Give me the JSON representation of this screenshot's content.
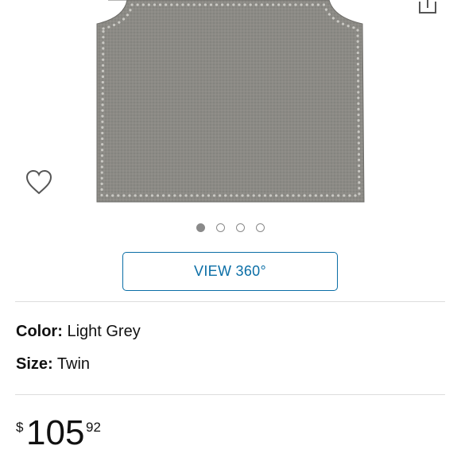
{
  "colors": {
    "accent": "#0a6ea6",
    "divider": "#dddddd",
    "fabric": "#8b8a85",
    "dot_active": "#8a8a8a"
  },
  "gallery": {
    "image_name": "headboard-product-image",
    "image_count": 4,
    "active_index": 0
  },
  "icons": {
    "wishlist": "heart-outline-icon",
    "share": "share-icon"
  },
  "view360": {
    "label": "VIEW 360°"
  },
  "attributes": {
    "color_label": "Color:",
    "color_value": "Light Grey",
    "size_label": "Size:",
    "size_value": "Twin"
  },
  "price": {
    "symbol": "$",
    "whole": "105",
    "fraction": "92"
  }
}
